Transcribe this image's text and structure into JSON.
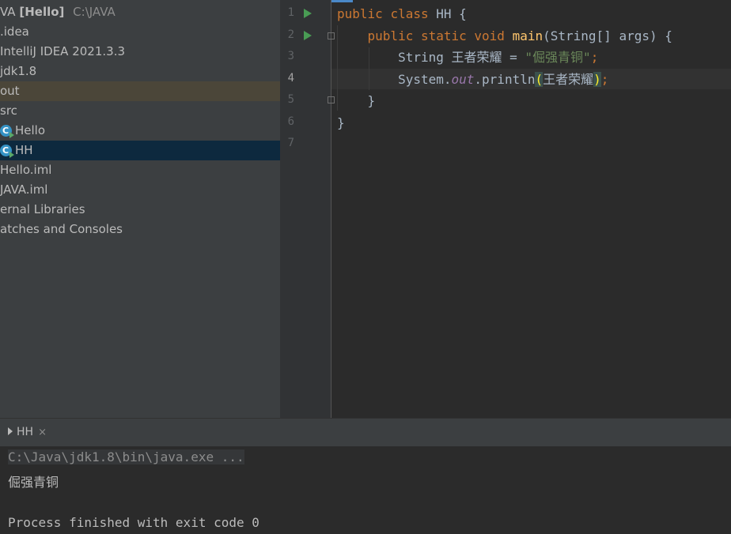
{
  "project": {
    "root": {
      "name": "VA",
      "module": "[Hello]",
      "path": "C:\\JAVA"
    },
    "items": [
      {
        "label": ".idea"
      },
      {
        "label": "IntelliJ IDEA 2021.3.3"
      },
      {
        "label": "jdk1.8"
      },
      {
        "label": "out"
      },
      {
        "label": "src"
      },
      {
        "label": "Hello"
      },
      {
        "label": "HH"
      },
      {
        "label": "Hello.iml"
      },
      {
        "label": "JAVA.iml"
      },
      {
        "label": "ernal Libraries"
      },
      {
        "label": "atches and Consoles"
      }
    ]
  },
  "editor": {
    "line_numbers": [
      "1",
      "2",
      "3",
      "4",
      "5",
      "6",
      "7"
    ],
    "code": {
      "l1_kw1": "public",
      "l1_kw2": "class",
      "l1_name": " HH {",
      "l2_kw1": "public",
      "l2_kw2": "static",
      "l2_kw3": "void",
      "l2_fn": "main",
      "l2_rest": "(String[] args) {",
      "l3_type": "String ",
      "l3_var": "王者荣耀",
      "l3_eq": " = ",
      "l3_str": "\"倔强青铜\"",
      "l3_semi": ";",
      "l4_sys": "System.",
      "l4_out": "out",
      "l4_print": ".println",
      "l4_open": "(",
      "l4_arg": "王者荣耀",
      "l4_close": ")",
      "l4_semi": ";",
      "l5": "}",
      "l6": "}"
    }
  },
  "run": {
    "tab_label": "HH",
    "close_glyph": "×",
    "console": {
      "command": "C:\\Java\\jdk1.8\\bin\\java.exe ...",
      "output": "倔强青铜",
      "exit": "Process finished with exit code 0"
    }
  }
}
